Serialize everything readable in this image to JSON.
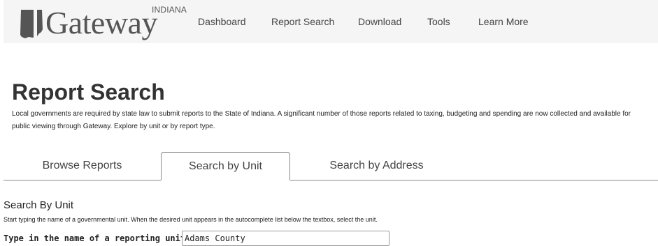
{
  "header": {
    "logo": {
      "wordmark": "Gateway",
      "state_label": "INDIANA",
      "icon": "indiana-state-icon"
    },
    "nav": [
      {
        "label": "Dashboard"
      },
      {
        "label": "Report Search"
      },
      {
        "label": "Download"
      },
      {
        "label": "Tools"
      },
      {
        "label": "Learn More"
      }
    ]
  },
  "page": {
    "title": "Report Search",
    "intro": "Local governments are required by state law to submit reports to the State of Indiana. A significant number of those reports related to taxing, budgeting and spending are now collected and available for public viewing through Gateway. Explore by unit or by report type."
  },
  "tabs": {
    "items": [
      {
        "label": "Browse Reports"
      },
      {
        "label": "Search by Unit"
      },
      {
        "label": "Search by Address"
      }
    ],
    "active": "Search by Unit"
  },
  "search_by_unit": {
    "heading": "Search By Unit",
    "instructions": "Start typing the name of a governmental unit. When the desired unit appears in the autocomplete list below the textbox, select the unit.",
    "field_label": "Type in the name of a reporting unit:",
    "input_value": "Adams County"
  },
  "colors": {
    "header_bg": "#f5f5f5",
    "logo_gray": "#555555",
    "tab_border": "#888888"
  }
}
